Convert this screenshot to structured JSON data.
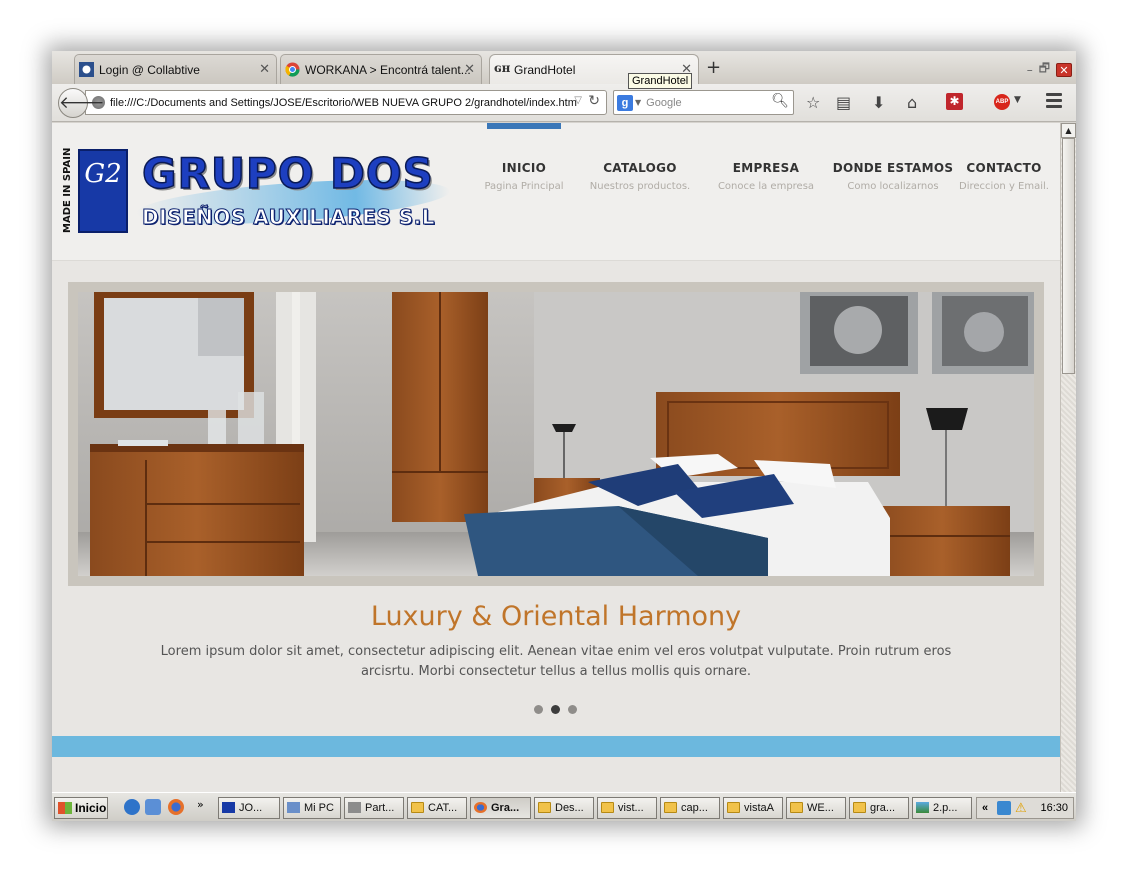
{
  "browser": {
    "tabs": [
      {
        "title": "Login @ Collabtive",
        "active": false
      },
      {
        "title": "WORKANA > Encontrá talent...",
        "active": false
      },
      {
        "title": "GrandHotel",
        "active": true
      }
    ],
    "tooltip": "GrandHotel",
    "url": "file:///C:/Documents and Settings/JOSE/Escritorio/WEB NUEVA GRUPO 2/grandhotel/index.htm",
    "search_placeholder": "Google",
    "search_engine_letter": "g",
    "window_controls": {
      "minimize": "–",
      "restore": "🗗",
      "close": "✕"
    },
    "new_tab": "+",
    "abp_label": "ABP"
  },
  "site": {
    "logo": {
      "made_in": "MADE IN SPAIN",
      "monogram": "G2",
      "main": "GRUPO DOS",
      "sub": "DISEÑOS AUXILIARES S.L"
    },
    "menu": [
      {
        "label": "INICIO",
        "sub": "Pagina Principal",
        "active": true
      },
      {
        "label": "CATALOGO",
        "sub": "Nuestros productos."
      },
      {
        "label": "EMPRESA",
        "sub": "Conoce la empresa"
      },
      {
        "label": "DONDE ESTAMOS",
        "sub": "Como localizarnos"
      },
      {
        "label": "CONTACTO",
        "sub": "Direccion y Email."
      }
    ],
    "slider": {
      "title": "Luxury & Oriental Harmony",
      "description": "Lorem ipsum dolor sit amet, consectetur adipiscing elit. Aenean vitae enim vel eros volutpat vulputate. Proin rutrum eros arcisrtu. Morbi consectetur tellus a tellus mollis quis ornare.",
      "dots": 3,
      "active_dot": 2
    }
  },
  "taskbar": {
    "start_label": "Inicio",
    "quicklaunch_more": "»",
    "tasks": [
      {
        "label": "JO...",
        "icon": "app"
      },
      {
        "label": "Mi PC",
        "icon": "pc"
      },
      {
        "label": "Part...",
        "icon": "drive"
      },
      {
        "label": "CAT...",
        "icon": "folder"
      },
      {
        "label": "Gra...",
        "icon": "firefox",
        "active": true
      },
      {
        "label": "Des...",
        "icon": "folder"
      },
      {
        "label": "vist...",
        "icon": "folder"
      },
      {
        "label": "cap...",
        "icon": "folder"
      },
      {
        "label": "vistaA",
        "icon": "folder"
      },
      {
        "label": "WE...",
        "icon": "folder"
      },
      {
        "label": "gra...",
        "icon": "folder"
      },
      {
        "label": "2.p...",
        "icon": "image"
      }
    ],
    "tray_expand": "«",
    "clock": "16:30"
  },
  "colors": {
    "accent": "#3a77b8",
    "slide_title": "#c0752a",
    "band": "#6cb8de",
    "logo_blue": "#1d3fc0"
  }
}
